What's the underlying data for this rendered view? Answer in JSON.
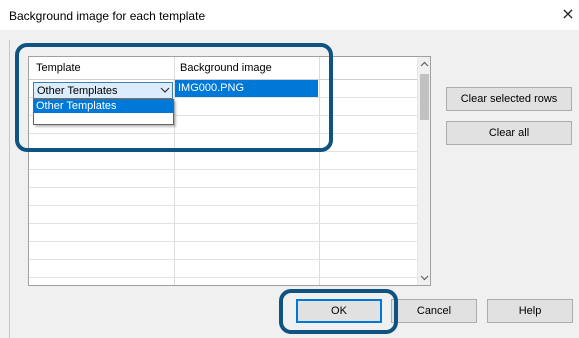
{
  "dialog": {
    "title": "Background image for each template",
    "close_symbol": "×"
  },
  "grid": {
    "columns": [
      "Template",
      "Background image"
    ],
    "rows": [
      {
        "template": "Other Templates",
        "background_image": "IMG000.PNG"
      }
    ],
    "dropdown_open": true,
    "dropdown_options": [
      "Other Templates"
    ]
  },
  "buttons": {
    "clear_selected": "Clear selected rows",
    "clear_all": "Clear all",
    "ok": "OK",
    "cancel": "Cancel",
    "help": "Help"
  },
  "colors": {
    "selection": "#0078d7",
    "highlight_frame": "#0f5381",
    "dialog_bg": "#f0f0f0"
  },
  "icons": [
    "close-icon",
    "chevron-down-icon",
    "scroll-up-arrow-icon",
    "scroll-down-arrow-icon"
  ]
}
